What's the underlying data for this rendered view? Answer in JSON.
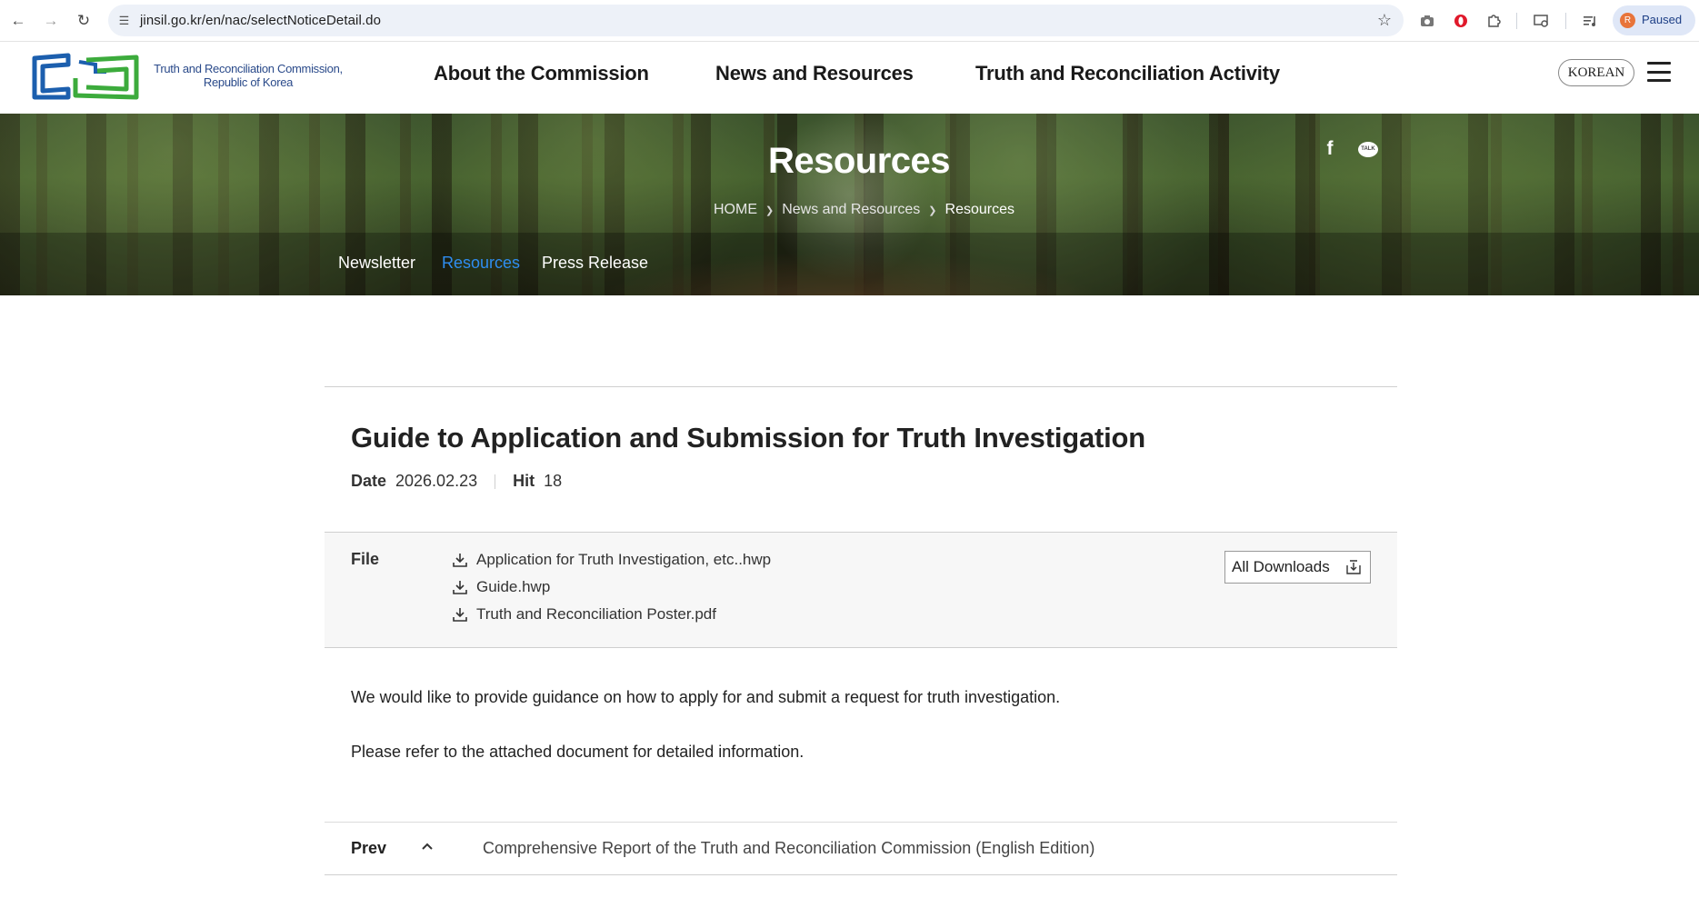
{
  "browser": {
    "url": "jinsil.go.kr/en/nac/selectNoticeDetail.do",
    "profile_initial": "R",
    "profile_status": "Paused"
  },
  "header": {
    "logo_line1": "Truth and Reconciliation Commission,",
    "logo_line2": "Republic of Korea",
    "nav": [
      "About the Commission",
      "News and Resources",
      "Truth and Reconciliation Activity"
    ],
    "language_button": "KOREAN"
  },
  "hero": {
    "title": "Resources",
    "breadcrumb": [
      "HOME",
      "News and Resources",
      "Resources"
    ],
    "talk_label": "TALK",
    "subnav": [
      {
        "label": "Newsletter",
        "active": false
      },
      {
        "label": "Resources",
        "active": true
      },
      {
        "label": "Press Release",
        "active": false
      }
    ],
    "active_color": "#2f8df0"
  },
  "post": {
    "title": "Guide to Application and Submission for Truth Investigation",
    "date_label": "Date",
    "date": "2026.02.23",
    "hit_label": "Hit",
    "hits": "18",
    "file_label": "File",
    "files": [
      "Application for Truth Investigation, etc..hwp",
      "Guide.hwp",
      "Truth and Reconciliation Poster.pdf"
    ],
    "all_downloads": "All Downloads",
    "paragraphs": [
      "We would like to provide guidance on how to apply for and submit a request for truth investigation.",
      "Please refer to the attached document for detailed information."
    ]
  },
  "pagination": {
    "prev_label": "Prev",
    "prev_title": "Comprehensive Report of the Truth and Reconciliation Commission (English Edition)"
  }
}
